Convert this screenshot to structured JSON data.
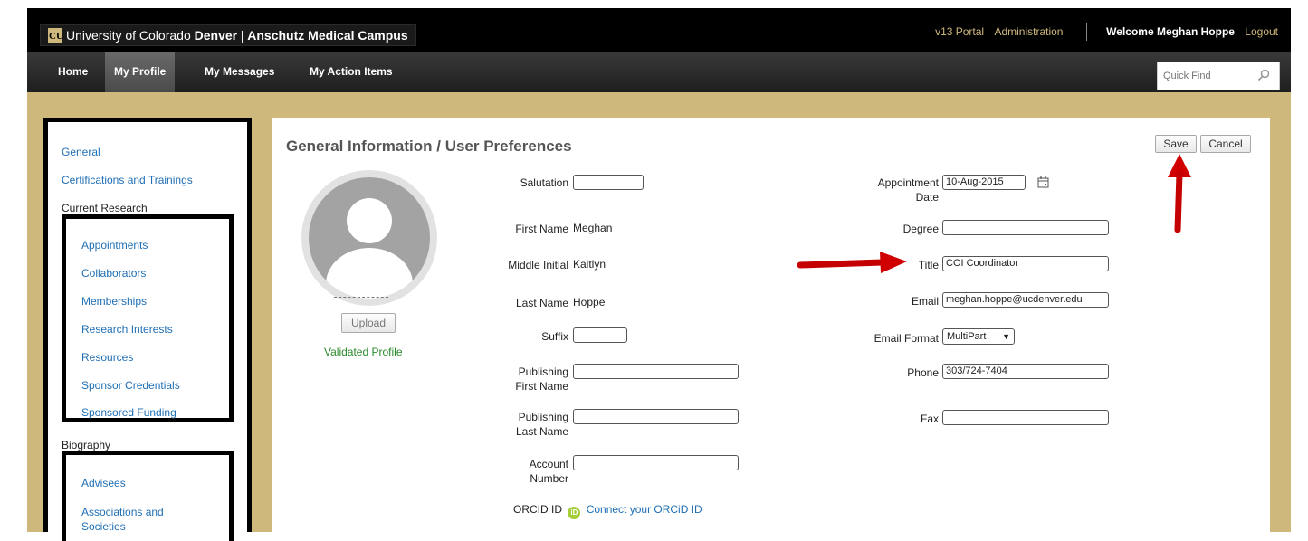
{
  "header": {
    "brand_prefix": "University of Colorado ",
    "brand_bold": "Denver | Anschutz Medical Campus",
    "links": {
      "portal": "v13 Portal",
      "admin": "Administration"
    },
    "welcome": "Welcome Meghan Hoppe",
    "logout": "Logout"
  },
  "nav": {
    "items": [
      {
        "label": "Home"
      },
      {
        "label": "My Profile"
      },
      {
        "label": "My Messages"
      },
      {
        "label": "My Action Items"
      }
    ],
    "active": "My Profile",
    "quick_find_placeholder": "Quick Find"
  },
  "sidebar": {
    "general": "General",
    "certifications": "Certifications and Trainings",
    "current_research": "Current Research",
    "research_items": [
      "Appointments",
      "Collaborators",
      "Memberships",
      "Research Interests",
      "Resources",
      "Sponsor Credentials",
      "Sponsored Funding"
    ],
    "biography": "Biography",
    "biography_items": [
      "Advisees",
      "Associations and Societies"
    ]
  },
  "main": {
    "title": "General Information / User Preferences",
    "save": "Save",
    "cancel": "Cancel",
    "upload": "Upload",
    "validated": "Validated Profile",
    "left_fields": {
      "salutation_label": "Salutation",
      "salutation_value": "",
      "first_name_label": "First Name",
      "first_name_value": "Meghan",
      "middle_initial_label": "Middle Initial",
      "middle_initial_value": "Kaitlyn",
      "last_name_label": "Last Name",
      "last_name_value": "Hoppe",
      "suffix_label": "Suffix",
      "suffix_value": "",
      "pub_first_label_1": "Publishing",
      "pub_first_label_2": "First Name",
      "pub_first_value": "",
      "pub_last_label_1": "Publishing",
      "pub_last_label_2": "Last Name",
      "pub_last_value": "",
      "account_label_1": "Account",
      "account_label_2": "Number",
      "account_value": "",
      "orcid_label": "ORCID ID",
      "orcid_badge": "iD",
      "orcid_link": "Connect your ORCiD ID"
    },
    "right_fields": {
      "appt_label_1": "Appointment",
      "appt_label_2": "Date",
      "appt_value": "10-Aug-2015",
      "degree_label": "Degree",
      "degree_value": "",
      "title_label": "Title",
      "title_value": "COI Coordinator",
      "email_label": "Email",
      "email_value": "meghan.hoppe@ucdenver.edu",
      "email_format_label": "Email Format",
      "email_format_value": "MultiPart",
      "phone_label": "Phone",
      "phone_value": "303/724-7404",
      "fax_label": "Fax",
      "fax_value": ""
    }
  },
  "colors": {
    "gold": "#cfb87c",
    "link": "#1f6fb5",
    "annotation_arrow": "#e00000",
    "validated": "#2b8a2b"
  }
}
